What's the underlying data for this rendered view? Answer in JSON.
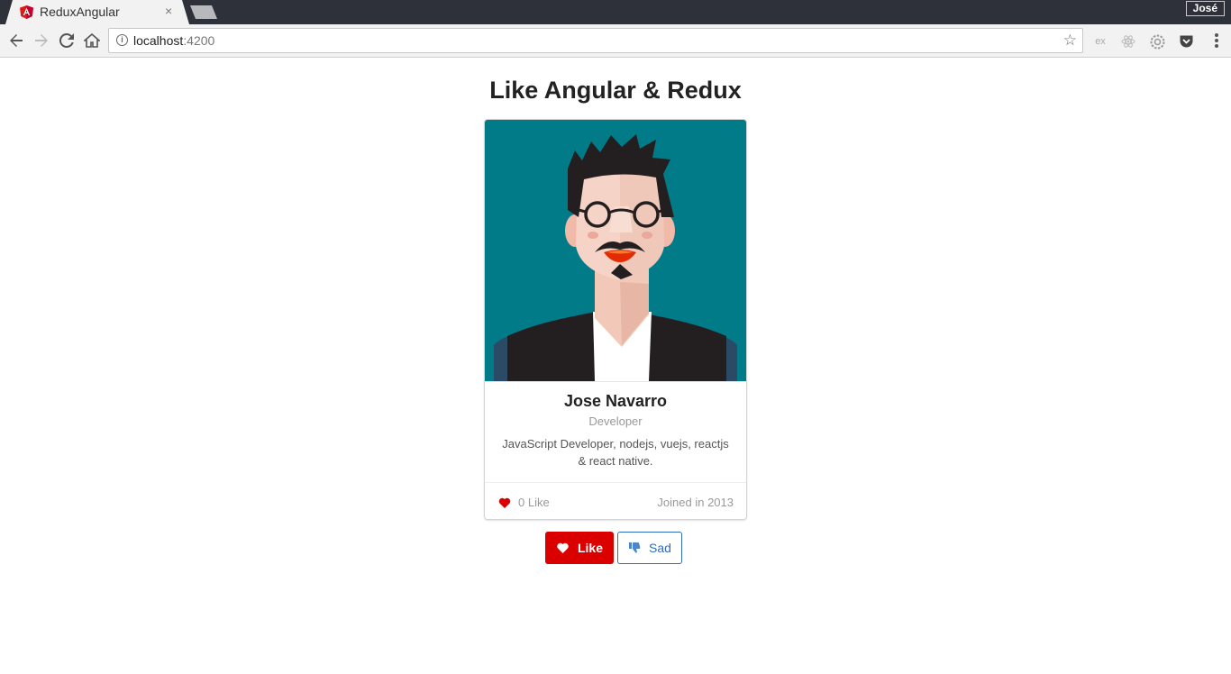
{
  "browser": {
    "tab_title": "ReduxAngular",
    "tab_close": "×",
    "profile_name": "José",
    "url_host": "localhost",
    "url_port": ":4200",
    "extensions": [
      "ex",
      "react-icon",
      "gear-icon",
      "pocket-icon"
    ]
  },
  "page": {
    "title": "Like Angular & Redux"
  },
  "card": {
    "name": "Jose Navarro",
    "role": "Developer",
    "description": "JavaScript Developer, nodejs, vuejs, reactjs & react native.",
    "likes": "0 Like",
    "joined": "Joined in 2013"
  },
  "buttons": {
    "like": "Like",
    "sad": "Sad"
  },
  "colors": {
    "card_image_bg": "#027b89",
    "like_button": "#db0000",
    "sad_button": "#2f6cc0"
  }
}
